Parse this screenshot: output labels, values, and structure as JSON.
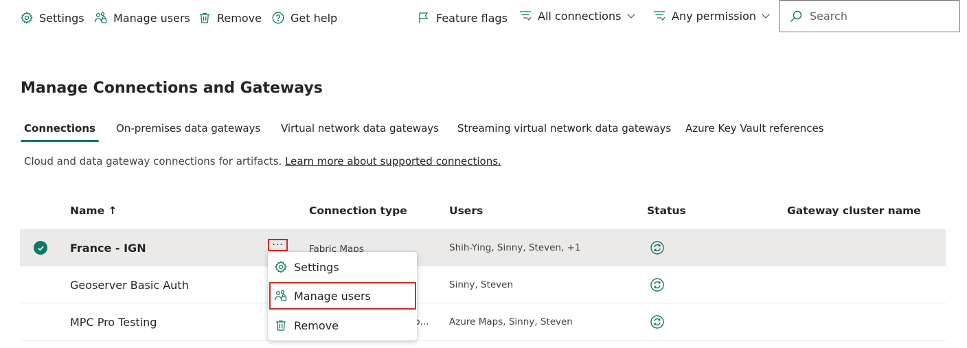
{
  "toolbar": {
    "settings_label": "Settings",
    "manage_users_label": "Manage users",
    "remove_label": "Remove",
    "get_help_label": "Get help",
    "feature_flags_label": "Feature flags",
    "connections_filter": {
      "selected": "All connections",
      "icon": "filter-icon"
    },
    "permission_filter": {
      "selected": "Any permission",
      "icon": "filter-icon"
    },
    "search": {
      "placeholder": "Search",
      "value": ""
    }
  },
  "page": {
    "title": "Manage Connections and Gateways",
    "tabs": [
      {
        "label": "Connections",
        "active": true
      },
      {
        "label": "On-premises data gateways",
        "active": false
      },
      {
        "label": "Virtual network data gateways",
        "active": false
      },
      {
        "label": "Streaming virtual network data gateways",
        "active": false
      },
      {
        "label": "Azure Key Vault references",
        "active": false
      }
    ],
    "description": "Cloud and data gateway connections for artifacts.",
    "learn_more_link": "Learn more about supported connections."
  },
  "table": {
    "columns": {
      "name": "Name ↑",
      "connection_type": "Connection type",
      "users": "Users",
      "status": "Status",
      "gateway_cluster": "Gateway cluster name"
    },
    "rows": [
      {
        "name": "France - IGN",
        "connection_type": "Fabric Maps",
        "users": "Shih-Ying, Sinny, Steven, +1",
        "status_icon": "sync-icon",
        "selected": true
      },
      {
        "name": "Geoserver Basic Auth",
        "connection_type": "",
        "users": "Sinny, Steven",
        "status_icon": "sync-icon",
        "selected": false
      },
      {
        "name": "MPC Pro Testing",
        "connection_type": "p...",
        "users": "Azure Maps, Sinny, Steven",
        "status_icon": "sync-icon",
        "selected": false
      }
    ],
    "more_options_glyph": "···"
  },
  "context_menu": {
    "items": [
      {
        "label": "Settings",
        "icon": "gear-icon"
      },
      {
        "label": "Manage users",
        "icon": "manage-users-icon",
        "highlighted": true
      },
      {
        "label": "Remove",
        "icon": "trash-icon"
      }
    ]
  },
  "colors": {
    "accent": "#117865",
    "highlight_border": "#d9281f",
    "selected_row": "#ebeae8"
  }
}
